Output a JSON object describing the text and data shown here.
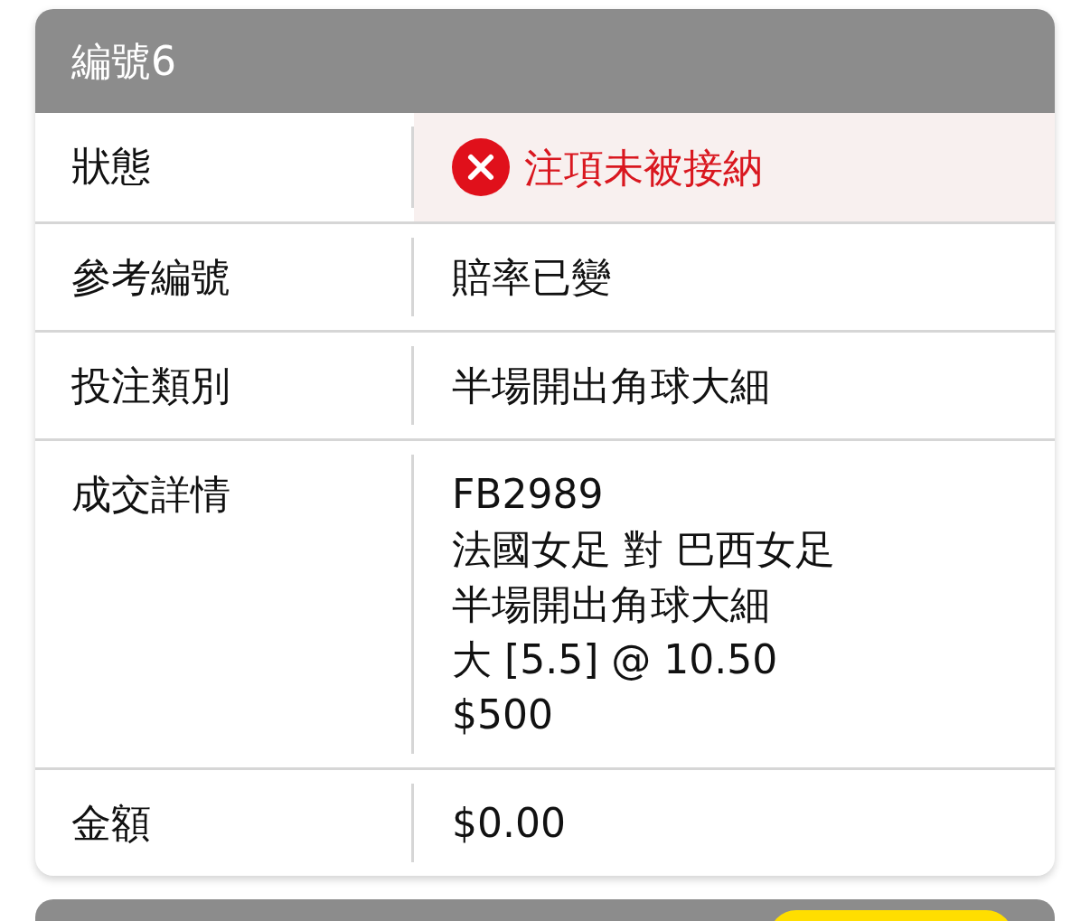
{
  "card": {
    "title": "編號6",
    "rows": [
      {
        "kind": "status",
        "label": "狀態",
        "value": "注項未被接納",
        "accepted": false
      },
      {
        "kind": "text",
        "label": "參考編號",
        "value": "賠率已變"
      },
      {
        "kind": "text",
        "label": "投注類別",
        "value": "半場開出角球大細"
      },
      {
        "kind": "lines",
        "label": "成交詳情",
        "lines": [
          "FB2989",
          "法國女足 對 巴西女足",
          "半場開出角球大細",
          "大 [5.5] @ 10.50",
          "$500"
        ]
      },
      {
        "kind": "text",
        "label": "金額",
        "value": "$0.00"
      }
    ]
  }
}
